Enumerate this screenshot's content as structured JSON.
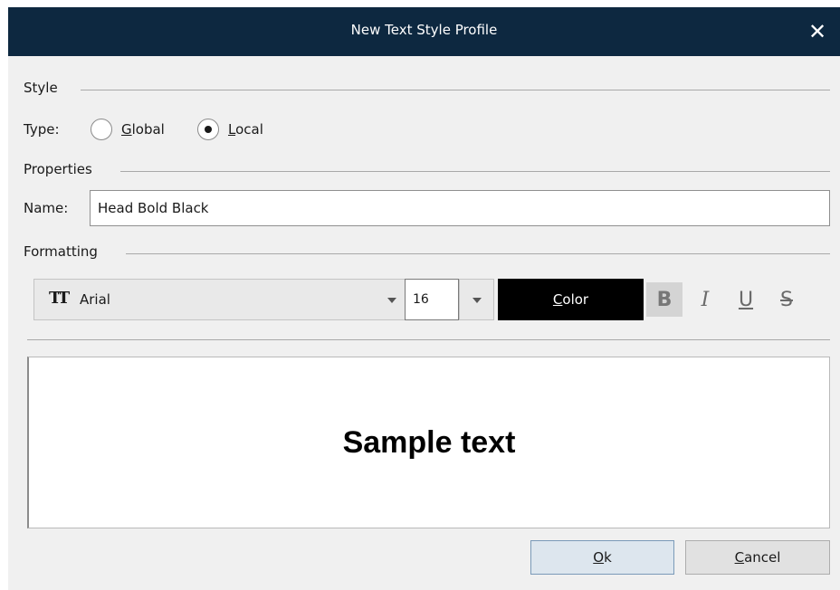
{
  "window": {
    "title": "New Text Style Profile",
    "close_glyph": "✕"
  },
  "style_group": {
    "label": "Style",
    "type_label": "Type:",
    "options": [
      {
        "label_prefix": "",
        "mnemonic": "G",
        "label_rest": "lobal",
        "checked": false
      },
      {
        "label_prefix": "",
        "mnemonic": "L",
        "label_rest": "ocal",
        "checked": true
      }
    ]
  },
  "properties_group": {
    "label": "Properties",
    "name_label": "Name:",
    "name_value": "Head Bold Black"
  },
  "formatting_group": {
    "label": "Formatting",
    "font_icon": "font-icon",
    "font_icon_glyph": "TT",
    "font_name": "Arial",
    "font_size": "16",
    "color_button": {
      "mnemonic": "C",
      "label_rest": "olor",
      "swatch": "#000000"
    },
    "bold_glyph": "B",
    "italic_glyph": "I",
    "underline_glyph": "U",
    "strike_glyph": "S",
    "bold_active": true
  },
  "preview": {
    "sample_text": "Sample text"
  },
  "buttons": {
    "ok": {
      "mnemonic": "O",
      "label_rest": "k"
    },
    "cancel": {
      "mnemonic": "C",
      "label_rest": "ancel"
    }
  },
  "colors": {
    "titlebar": "#0d2840",
    "dialog_bg": "#f0f0f0",
    "color_swatch": "#000000"
  }
}
